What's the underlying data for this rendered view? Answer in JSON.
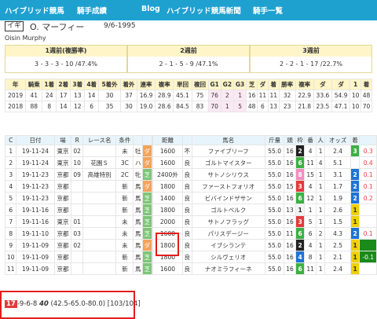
{
  "nav": {
    "site": "ハイブリッド競馬",
    "section": "騎手成績",
    "links": [
      "Blog",
      "ハイブリッド競馬新聞",
      "騎手一覧"
    ]
  },
  "jockey": {
    "badge": "イギ",
    "name": "O. マーフィー",
    "date": "9/6-1995",
    "english": "Oisin Murphy"
  },
  "periods": [
    {
      "label": "1週前(複勝率)",
      "value": "3 - 3 - 3 - 10 /47.4%"
    },
    {
      "label": "2週前",
      "value": "2 - 1 - 5 - 9 /47.1%"
    },
    {
      "label": "3週前",
      "value": "2 - 2 - 1 - 17 /22.7%"
    }
  ],
  "stats": {
    "headers": [
      "年",
      "騎乗",
      "1着",
      "2着",
      "3着",
      "4着",
      "5着外",
      "着外",
      "連率",
      "複率",
      "単回",
      "複回",
      "G1",
      "G2",
      "G3",
      "芝",
      "ダ",
      "着",
      "勝率",
      "複率",
      "ダ",
      "ダ",
      "1",
      "着"
    ],
    "rows": [
      [
        "2019",
        "41",
        "24",
        "17",
        "13",
        "14",
        "30",
        "37",
        "16.9",
        "28.9",
        "45.1",
        "75",
        "76",
        "2",
        "1",
        "16",
        "11",
        "11",
        "32",
        "22.9",
        "33.6",
        "54.9",
        "10",
        "48"
      ],
      [
        "2018",
        "88",
        "8",
        "14",
        "12",
        "6",
        "35",
        "30",
        "19.0",
        "28.6",
        "84.5",
        "83",
        "70",
        "1",
        "5",
        "48",
        "6",
        "13",
        "23",
        "21.8",
        "23.5",
        "47.1",
        "10",
        "70"
      ]
    ]
  },
  "races": {
    "headers": [
      "C",
      "日付",
      "場",
      "R",
      "レース名",
      "条件",
      "",
      "",
      "",
      "距離",
      "",
      "馬名",
      "斤量",
      "頭",
      "枠",
      "番",
      "人",
      "オッズ",
      "着",
      ""
    ],
    "rows": [
      {
        "c": "1",
        "d": "8",
        "date": "19-11-24",
        "place": "東京",
        "r": "02",
        "race": "",
        "cond": "未",
        "sex": "牡",
        "surf": "ダ",
        "surfType": "d",
        "dist": "1600",
        "track": "不",
        "horse": "ファイブリーフ",
        "weight": "55.0",
        "heads": "16",
        "frame": "2",
        "num": "4",
        "pop": "1",
        "odds": "2.4",
        "rank": "3",
        "margin": "0.3",
        "rankClass": "rk3",
        "mClass": "neg"
      },
      {
        "c": "2",
        "d": "17",
        "date": "19-11-24",
        "place": "東京",
        "r": "10",
        "race": "花園Ｓ",
        "cond": "3C",
        "sex": "ハ",
        "surf": "ダ",
        "surfType": "d",
        "dist": "1600",
        "track": "良",
        "horse": "ゴルトマイスター",
        "weight": "55.0",
        "heads": "16",
        "frame": "6",
        "num": "11",
        "pop": "4",
        "odds": "5.1",
        "rank": "4",
        "margin": "0.4",
        "rankClass": "",
        "mClass": "neg"
      },
      {
        "c": "3",
        "d": "2",
        "date": "19-11-23",
        "place": "京都",
        "r": "09",
        "race": "高雄特別",
        "cond": "2C",
        "sex": "牝",
        "surf": "芝",
        "surfType": "t",
        "dist": "2400外",
        "track": "良",
        "horse": "サトノシリウス",
        "weight": "55.0",
        "heads": "16",
        "frame": "8",
        "num": "15",
        "pop": "1",
        "odds": "3.1",
        "rank": "2",
        "margin": "0.1",
        "rankClass": "rk2",
        "mClass": "neg"
      },
      {
        "c": "4",
        "d": "18",
        "date": "19-11-23",
        "place": "京都",
        "r": "",
        "race": "",
        "cond": "新",
        "sex": "馬",
        "surf": "ダ",
        "surfType": "d",
        "dist": "1800",
        "track": "良",
        "horse": "ファーストフォリオ",
        "weight": "55.0",
        "heads": "15",
        "frame": "3",
        "num": "4",
        "pop": "1",
        "odds": "1.7",
        "rank": "2",
        "margin": "0.1",
        "rankClass": "rk2",
        "mClass": "neg"
      },
      {
        "c": "5",
        "d": "",
        "date": "19-11-23",
        "place": "京都",
        "r": "",
        "race": "",
        "cond": "新",
        "sex": "馬",
        "surf": "芝",
        "surfType": "t",
        "dist": "1400",
        "track": "良",
        "horse": "ビバインドザサン",
        "weight": "55.0",
        "heads": "16",
        "frame": "6",
        "num": "12",
        "pop": "1",
        "odds": "1.9",
        "rank": "2",
        "margin": "0.2",
        "rankClass": "rk2",
        "mClass": "neg"
      },
      {
        "c": "6",
        "d": "",
        "date": "19-11-16",
        "place": "京都",
        "r": "",
        "race": "",
        "cond": "新",
        "sex": "馬",
        "surf": "芝",
        "surfType": "t",
        "dist": "1800",
        "track": "良",
        "horse": "ゴルトベルク",
        "weight": "55.0",
        "heads": "13",
        "frame": "1",
        "num": "1",
        "pop": "1",
        "odds": "2.6",
        "rank": "1",
        "margin": "",
        "rankClass": "rk1",
        "mClass": ""
      },
      {
        "c": "7",
        "d": "35",
        "date": "19-11-16",
        "place": "東京",
        "r": "01",
        "race": "",
        "cond": "未",
        "sex": "馬",
        "surf": "芝",
        "surfType": "t",
        "dist": "2000",
        "track": "良",
        "horse": "サトノフラッグ",
        "weight": "55.0",
        "heads": "16",
        "frame": "3",
        "num": "5",
        "pop": "1",
        "odds": "1.5",
        "rank": "1",
        "margin": "",
        "rankClass": "rk1",
        "mClass": ""
      },
      {
        "c": "8",
        "d": "46",
        "date": "19-11-10",
        "place": "京都",
        "r": "03",
        "race": "",
        "cond": "未",
        "sex": "馬",
        "surf": "芝",
        "surfType": "t",
        "dist": "1600",
        "track": "良",
        "horse": "パリスデージー",
        "weight": "55.0",
        "heads": "11",
        "frame": "6",
        "num": "6",
        "pop": "2",
        "odds": "4.3",
        "rank": "2",
        "margin": "0.1",
        "rankClass": "rk2",
        "mClass": "neg"
      },
      {
        "c": "9",
        "d": "11",
        "date": "19-11-09",
        "place": "京都",
        "r": "02",
        "race": "",
        "cond": "未",
        "sex": "馬",
        "surf": "ダ",
        "surfType": "d",
        "dist": "1800",
        "track": "良",
        "horse": "イブシランテ",
        "weight": "55.0",
        "heads": "16",
        "frame": "2",
        "num": "4",
        "pop": "1",
        "odds": "2.5",
        "rank": "1",
        "margin": "",
        "rankClass": "rk1",
        "mClass": "pos"
      },
      {
        "c": "10",
        "d": "1",
        "date": "19-11-09",
        "place": "京都",
        "r": "",
        "race": "",
        "cond": "新",
        "sex": "馬",
        "surf": "芝",
        "surfType": "t",
        "dist": "1800",
        "track": "良",
        "horse": "シルヴェリオ",
        "weight": "55.0",
        "heads": "16",
        "frame": "4",
        "num": "8",
        "pop": "1",
        "odds": "2.1",
        "rank": "1",
        "margin": "-0.1",
        "rankClass": "rk1",
        "mClass": "pos"
      },
      {
        "c": "11",
        "d": "18",
        "date": "19-11-09",
        "place": "京都",
        "r": "",
        "race": "",
        "cond": "新",
        "sex": "馬",
        "surf": "芝",
        "surfType": "t",
        "dist": "1600",
        "track": "良",
        "horse": "ナオミラフィーネ",
        "weight": "55.0",
        "heads": "16",
        "frame": "6",
        "num": "11",
        "pop": "1",
        "odds": "2.4",
        "rank": "1",
        "margin": "",
        "rankClass": "rk1",
        "mClass": ""
      }
    ]
  },
  "footer": {
    "rank": "17",
    "text": "-9-6-8",
    "bold": "40",
    "detail": "(42.5-65.0-80.0) [103/104]"
  }
}
